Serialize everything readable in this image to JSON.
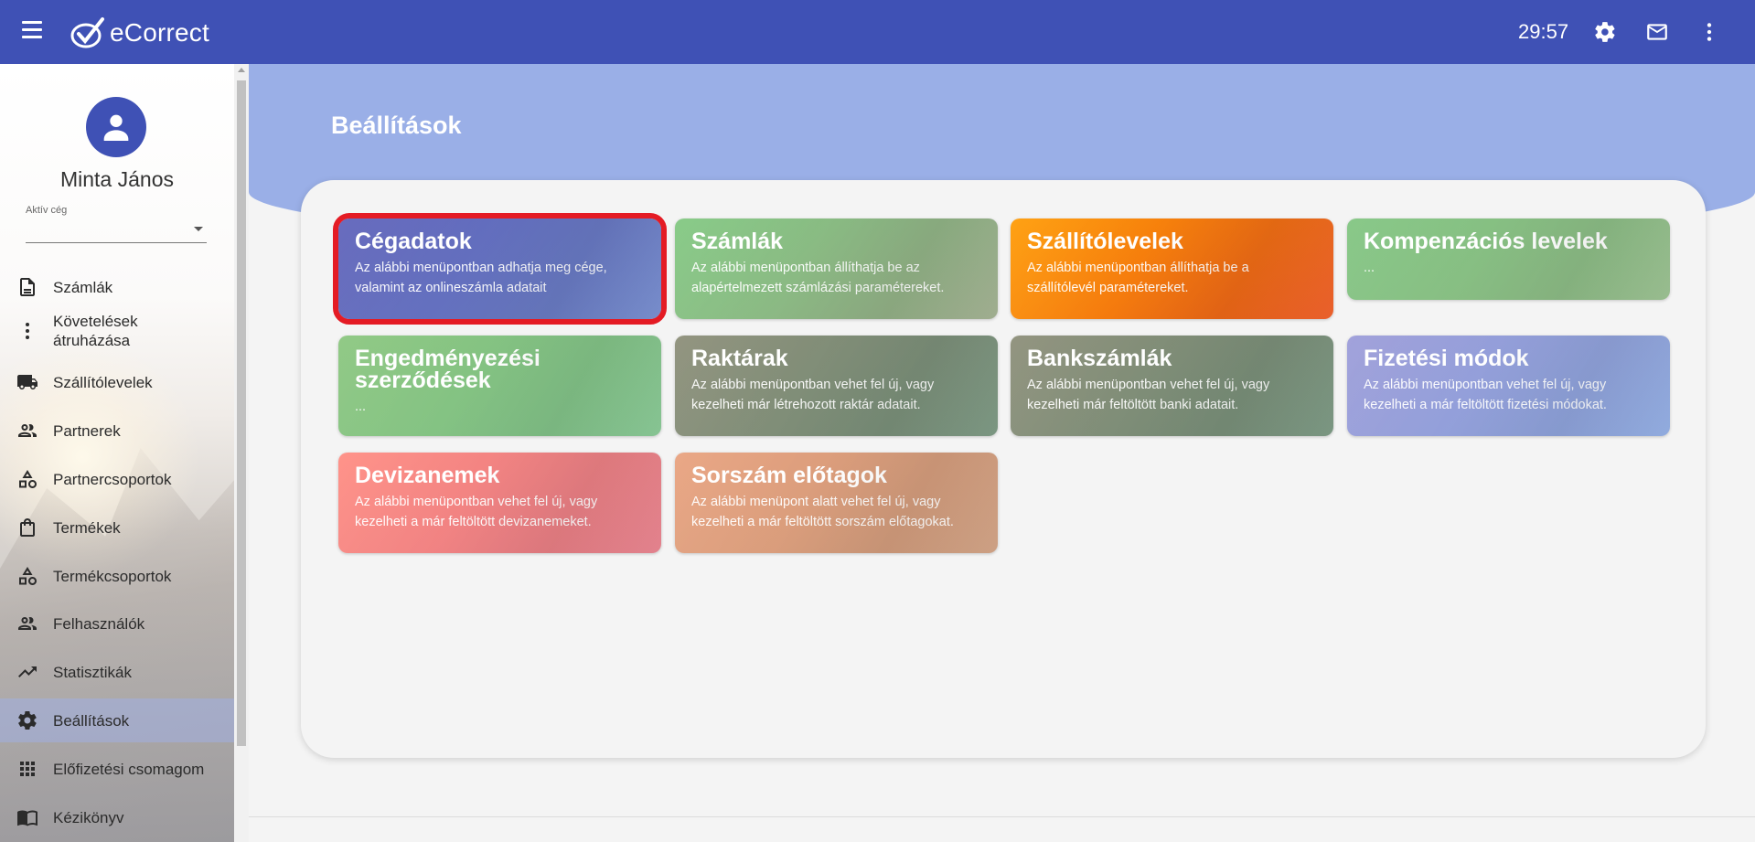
{
  "app": {
    "brand": "eCorrect",
    "timer": "29:57"
  },
  "user": {
    "name": "Minta János",
    "company_label": "Aktív cég",
    "company_value": ""
  },
  "nav": [
    {
      "label": "Számlák",
      "icon": "document-icon"
    },
    {
      "label": "Követelések\nátruházása",
      "icon": "more-vert-icon"
    },
    {
      "label": "Szállítólevelek",
      "icon": "truck-icon"
    },
    {
      "label": "Partnerek",
      "icon": "people-icon"
    },
    {
      "label": "Partnercsoportok",
      "icon": "category-icon"
    },
    {
      "label": "Termékek",
      "icon": "shopping-bag-icon"
    },
    {
      "label": "Termékcsoportok",
      "icon": "category-icon"
    },
    {
      "label": "Felhasználók",
      "icon": "people-icon"
    },
    {
      "label": "Statisztikák",
      "icon": "trending-icon"
    },
    {
      "label": "Beállítások",
      "icon": "gear-icon",
      "active": true
    },
    {
      "label": "Előfizetési csomagom",
      "icon": "apps-grid-icon"
    },
    {
      "label": "Kézikönyv",
      "icon": "book-icon"
    }
  ],
  "page": {
    "title": "Beállítások"
  },
  "cards": [
    {
      "title": "Cégadatok",
      "desc": "Az alábbi menüpontban adhatja meg cége, valamint az onlineszámla adatait",
      "color_from": "#5b5fb8",
      "color_to": "#6f86c8",
      "selected": true
    },
    {
      "title": "Számlák",
      "desc": "Az alábbi menüpontban állíthatja be az alapértelmezett számlázási paramétereket.",
      "color_from": "#7fc77f",
      "color_to": "#9aa889"
    },
    {
      "title": "Szállítólevelek",
      "desc": "Az alábbi menüpontban állíthatja be a szállítólevél paramétereket.",
      "color_from": "#ff9a00",
      "color_to": "#e8551f"
    },
    {
      "title": "Kompenzációs levelek",
      "desc": "...",
      "color_from": "#7fc47f",
      "color_to": "#92b888"
    },
    {
      "title": "Engedményezési szerződések",
      "desc": "...",
      "color_from": "#88c57c",
      "color_to": "#7fc08c"
    },
    {
      "title": "Raktárak",
      "desc": "Az alábbi menüpontban vehet fel új, vagy kezelheti már létrehozott raktár adatait.",
      "color_from": "#8a8c76",
      "color_to": "#73907a"
    },
    {
      "title": "Bankszámlák",
      "desc": "Az alábbi menüpontban vehet fel új, vagy kezelheti már feltöltött banki adatait.",
      "color_from": "#8a8c76",
      "color_to": "#72907a"
    },
    {
      "title": "Fizetési módok",
      "desc": "Az alábbi menüpontban vehet fel új, vagy kezelheti a már feltöltött fizetési módokat.",
      "color_from": "#9a9ad8",
      "color_to": "#8aa6dc"
    },
    {
      "title": "Devizanemek",
      "desc": "Az alábbi menüpontban vehet fel új, vagy kezelheti a már feltöltött devizanemeket.",
      "color_from": "#ff8a80",
      "color_to": "#e07a86"
    },
    {
      "title": "Sorszám előtagok",
      "desc": "Az alábbi menüpont alatt vehet fel új, vagy kezelheti a már feltöltött sorszám előtagokat.",
      "color_from": "#e8a07c",
      "color_to": "#c99a7c"
    }
  ]
}
